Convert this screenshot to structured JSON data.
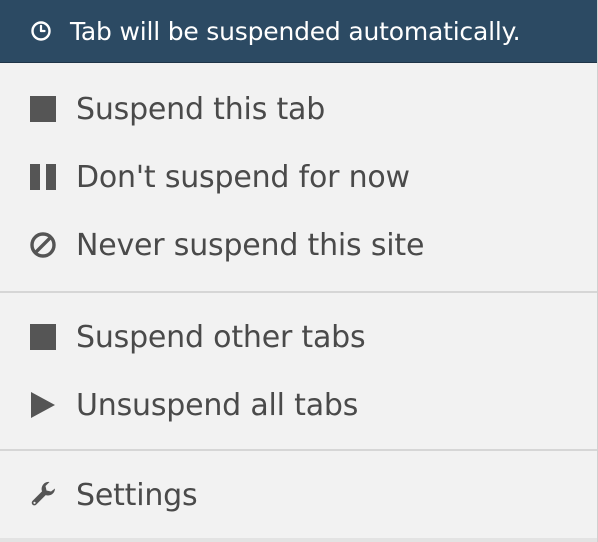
{
  "header": {
    "status_text": "Tab will be suspended automatically.",
    "icon": "clock-icon"
  },
  "menu": {
    "section1": [
      {
        "label": "Suspend this tab",
        "icon": "square-icon"
      },
      {
        "label": "Don't suspend for now",
        "icon": "pause-icon"
      },
      {
        "label": "Never suspend this site",
        "icon": "ban-icon"
      }
    ],
    "section2": [
      {
        "label": "Suspend other tabs",
        "icon": "square-icon"
      },
      {
        "label": "Unsuspend all tabs",
        "icon": "play-icon"
      }
    ],
    "section3": [
      {
        "label": "Settings",
        "icon": "wrench-icon"
      }
    ]
  },
  "colors": {
    "header_bg": "#2c4a63",
    "menu_bg": "#f2f2f2",
    "text": "#4a4a4a",
    "icon": "#555555"
  }
}
